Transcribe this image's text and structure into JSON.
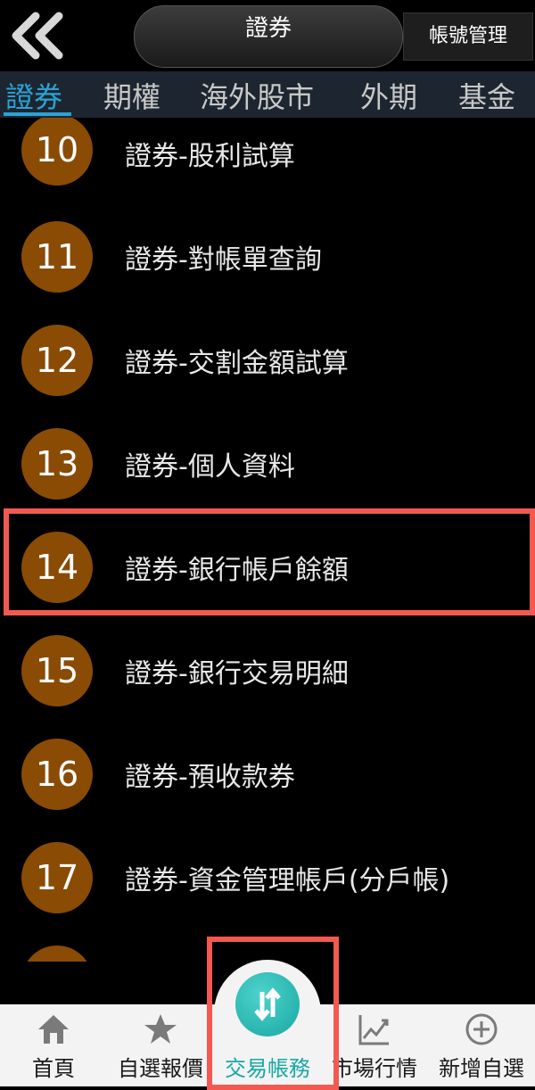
{
  "header": {
    "title": "證券",
    "account_manage": "帳號管理"
  },
  "tabs": [
    "證券",
    "期權",
    "海外股市",
    "外期",
    "基金"
  ],
  "items": [
    {
      "num": "10",
      "label": "證券-股利試算"
    },
    {
      "num": "11",
      "label": "證券-對帳單查詢"
    },
    {
      "num": "12",
      "label": "證券-交割金額試算"
    },
    {
      "num": "13",
      "label": "證券-個人資料"
    },
    {
      "num": "14",
      "label": "證券-銀行帳戶餘額"
    },
    {
      "num": "15",
      "label": "證券-銀行交易明細"
    },
    {
      "num": "16",
      "label": "證券-預收款券"
    },
    {
      "num": "17",
      "label": "證券-資金管理帳戶(分戶帳)"
    }
  ],
  "bottom_nav": {
    "home": "首頁",
    "watchlist": "自選報價",
    "trade": "交易帳務",
    "market": "市場行情",
    "add_watch": "新增自選"
  },
  "colors": {
    "accent": "#2ba3d6",
    "badge": "#8a4b05",
    "fab": "#17a8a2",
    "highlight": "#f35950"
  }
}
